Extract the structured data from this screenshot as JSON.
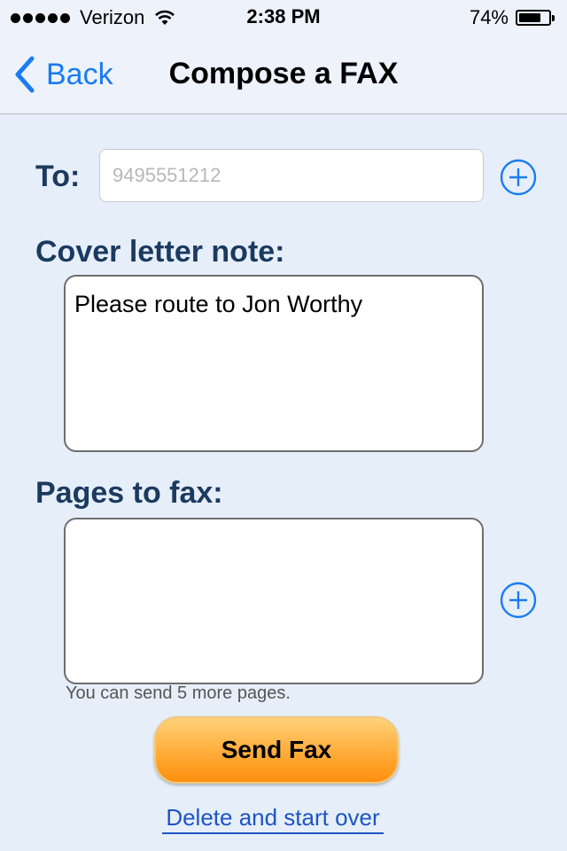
{
  "status_bar": {
    "carrier": "Verizon",
    "time": "2:38 PM",
    "battery_percent": "74%",
    "battery_level": 0.74,
    "signal_bars": 5
  },
  "nav": {
    "back_label": "Back",
    "title": "Compose a FAX",
    "accent_color": "#1a7cf0"
  },
  "form": {
    "to_label": "To:",
    "to_placeholder": "9495551212",
    "to_value": "",
    "cover_label": "Cover letter note:",
    "cover_text": "Please route to Jon Worthy",
    "pages_label": "Pages to fax:",
    "pages_note": "You can send 5 more pages.",
    "add_icon": "plus-circle-icon"
  },
  "actions": {
    "send_label": "Send Fax",
    "delete_label": "Delete and start over"
  },
  "colors": {
    "background": "#e6eef9",
    "label": "#1b3a5f",
    "send_button": "#ffa42e",
    "link": "#1d54c4"
  }
}
